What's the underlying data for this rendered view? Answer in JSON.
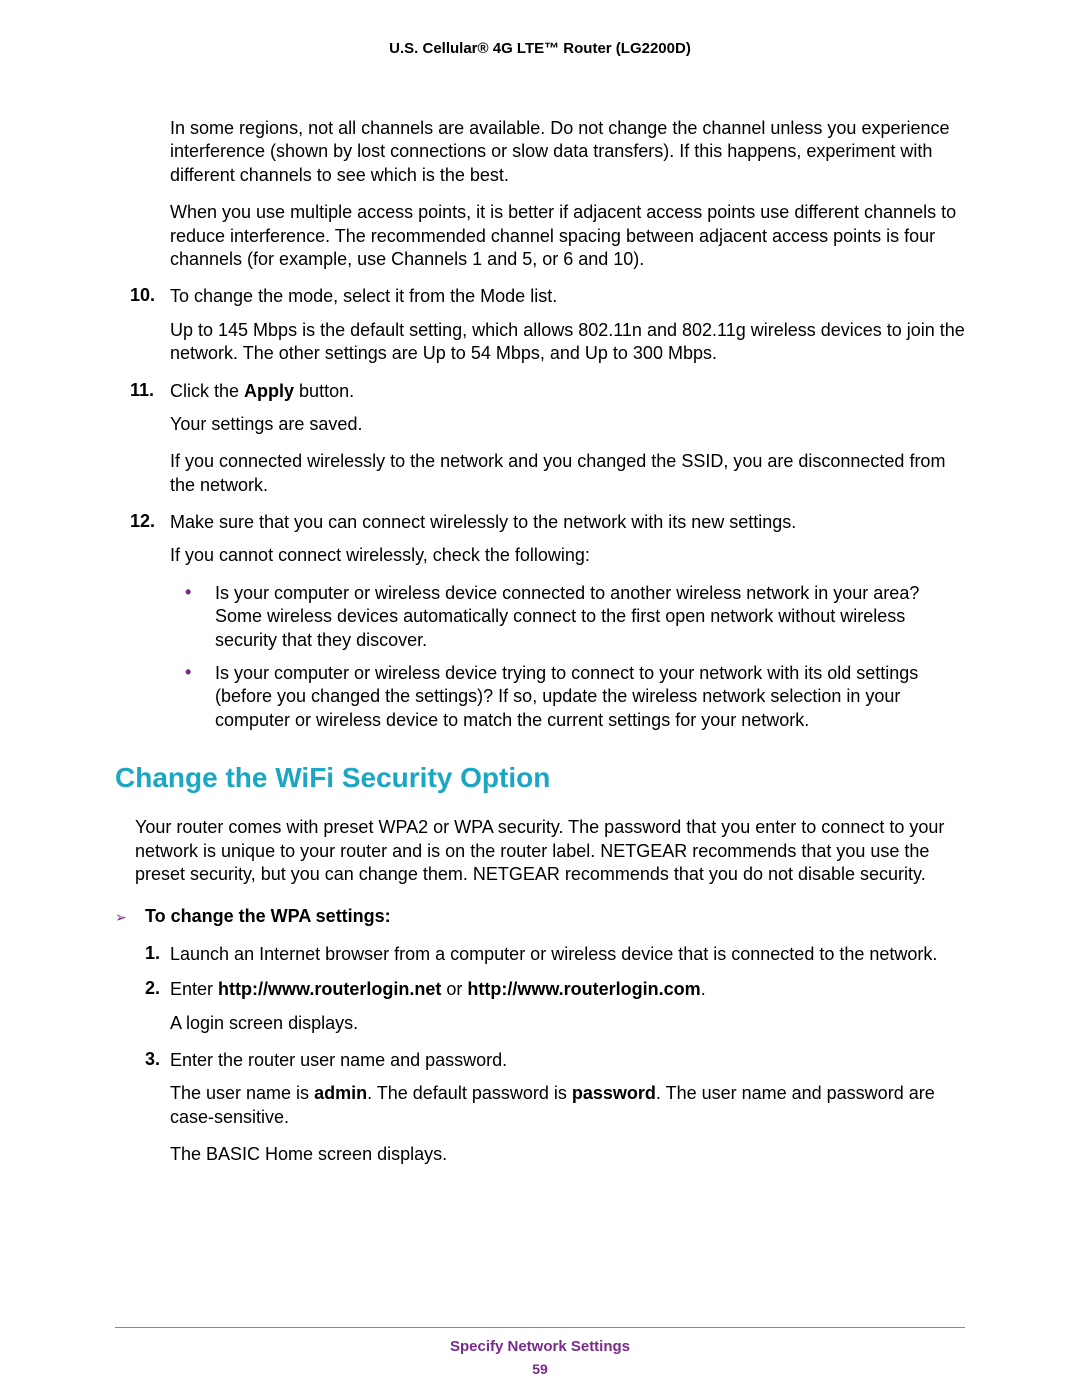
{
  "header": "U.S. Cellular® 4G LTE™ Router (LG2200D)",
  "p1": "In some regions, not all channels are available. Do not change the channel unless you experience interference (shown by lost connections or slow data transfers). If this happens, experiment with different channels to see which is the best.",
  "p2": "When you use multiple access points, it is better if adjacent access points use different channels to reduce interference. The recommended channel spacing between adjacent access points is four channels (for example, use Channels 1 and 5, or 6 and 10).",
  "n10": "10.",
  "n10_text": "To change the mode, select it from the Mode list.",
  "n10_sub": "Up to 145 Mbps is the default setting, which allows 802.11n and 802.11g wireless devices to join the network. The other settings are Up to 54 Mbps, and Up to 300 Mbps.",
  "n11": "11.",
  "n11_a": "Click the ",
  "n11_b": "Apply",
  "n11_c": " button.",
  "n11_s1": "Your settings are saved.",
  "n11_s2": "If you connected wirelessly to the network and you changed the SSID, you are disconnected from the network.",
  "n12": "12.",
  "n12_text": "Make sure that you can connect wirelessly to the network with its new settings.",
  "n12_s1": "If you cannot connect wirelessly, check the following:",
  "b1": "Is your computer or wireless device connected to another wireless network in your area? Some wireless devices automatically connect to the first open network without wireless security that they discover.",
  "b2": "Is your computer or wireless device trying to connect to your network with its old settings (before you changed the settings)? If so, update the wireless network selection in your computer or wireless device to match the current settings for your network.",
  "heading": "Change the WiFi Security Option",
  "intro": "Your router comes with preset WPA2 or WPA security. The password that you enter to connect to your network is unique to your router and is on the router label. NETGEAR recommends that you use the preset security, but you can change them. NETGEAR recommends that you do not disable security.",
  "proc_head": "To change the WPA settings:",
  "s1n": "1.",
  "s1": "Launch an Internet browser from a computer or wireless device that is connected to the network.",
  "s2n": "2.",
  "s2_a": "Enter ",
  "s2_b": "http://www.routerlogin.net",
  "s2_c": " or ",
  "s2_d": "http://www.routerlogin.com",
  "s2_e": ".",
  "s2_s1": "A login screen displays.",
  "s3n": "3.",
  "s3": "Enter the router user name and password.",
  "s3_s1a": "The user name is ",
  "s3_s1b": "admin",
  "s3_s1c": ". The default password is ",
  "s3_s1d": "password",
  "s3_s1e": ". The user name and password are case-sensitive.",
  "s3_s2": "The BASIC Home screen displays.",
  "footer_title": "Specify Network Settings",
  "footer_page": "59"
}
